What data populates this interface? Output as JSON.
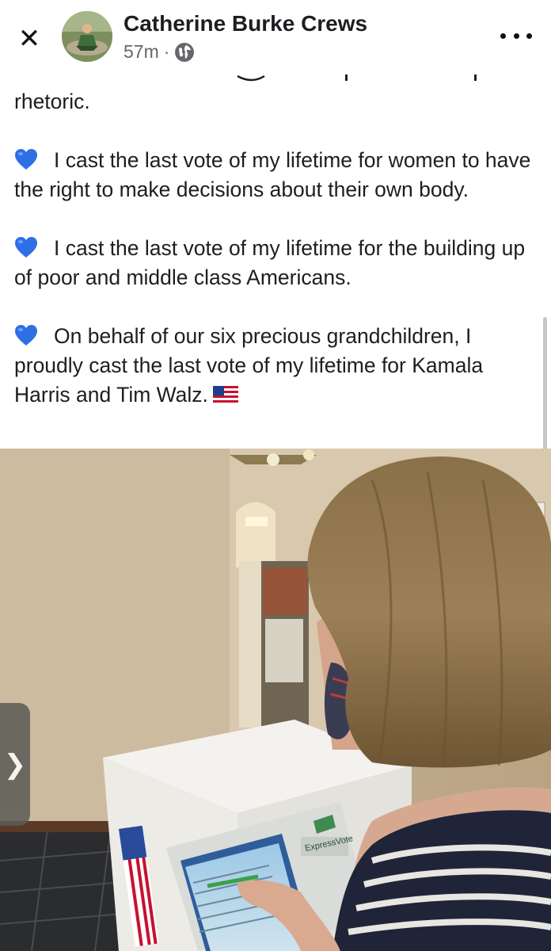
{
  "header": {
    "author": "Catherine Burke Crews",
    "time": "57m",
    "separator": "·",
    "close_icon": "close-icon",
    "more_icon": "more-options-icon",
    "privacy_icon": "globe-icon"
  },
  "post": {
    "intro_fragment": "rhetoric.",
    "paragraphs": [
      {
        "icon": "blue-heart-icon",
        "text": "I cast the last vote of my lifetime for women to have the right to make decisions about their own body."
      },
      {
        "icon": "blue-heart-icon",
        "text": "I cast the last vote of my lifetime for the building up of poor and middle class Americans."
      },
      {
        "icon": "blue-heart-icon",
        "text": "On behalf of our six precious grandchildren, I proudly cast the last vote of my lifetime for Kamala Harris and Tim Walz."
      }
    ],
    "flag_icon": "us-flag-icon"
  },
  "photo": {
    "machine_brand": "ExpressVote",
    "next_icon": "chevron-right-icon",
    "next_glyph": "❯"
  },
  "colors": {
    "heart": "#2f6fe6",
    "text": "#1c1e21",
    "meta": "#65676b"
  }
}
